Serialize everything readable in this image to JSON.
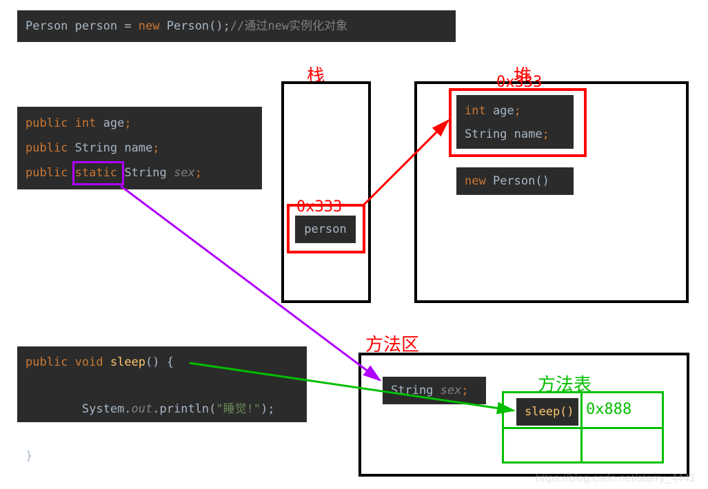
{
  "topline": {
    "t1": "Person",
    "t2": " person ",
    "t3": "= ",
    "t4": "new ",
    "t5": "Person()",
    "t6": ";",
    "comment": "//通过new实例化对象"
  },
  "fields": {
    "l1_kw": "public",
    "l1_type": " int ",
    "l1_name": "age",
    "l2_kw": "public",
    "l2_type": " String ",
    "l2_name": "name",
    "l3_kw": "public",
    "l3_mod": " static ",
    "l3_type": "String ",
    "l3_name": "sex",
    "semi": ";"
  },
  "method": {
    "l1_kw": "public",
    "l1_void": " void ",
    "l1_name": "sleep",
    "l1_rest": "() {",
    "l2_pre": "    System.",
    "l2_out": "out",
    "l2_mid": ".println(",
    "l2_str": "\"睡觉!\"",
    "l2_end": ");",
    "l3": "}"
  },
  "stack": {
    "title": "栈",
    "addr": "0x333",
    "var": "person"
  },
  "heap": {
    "title": "堆",
    "addr": "0x333",
    "f1_type": "int ",
    "f1_name": "age",
    "f2_type": "String ",
    "f2_name": "name",
    "semi": ";",
    "new_kw": "new ",
    "new_type": "Person()"
  },
  "methodarea": {
    "title": "方法区",
    "f_type": "String ",
    "f_name": "sex",
    "semi": ";",
    "tableTitle": "方法表",
    "m_name": "sleep()",
    "m_addr": "0x888"
  },
  "watermark": "https://blog.csdn.net/starry_4441"
}
